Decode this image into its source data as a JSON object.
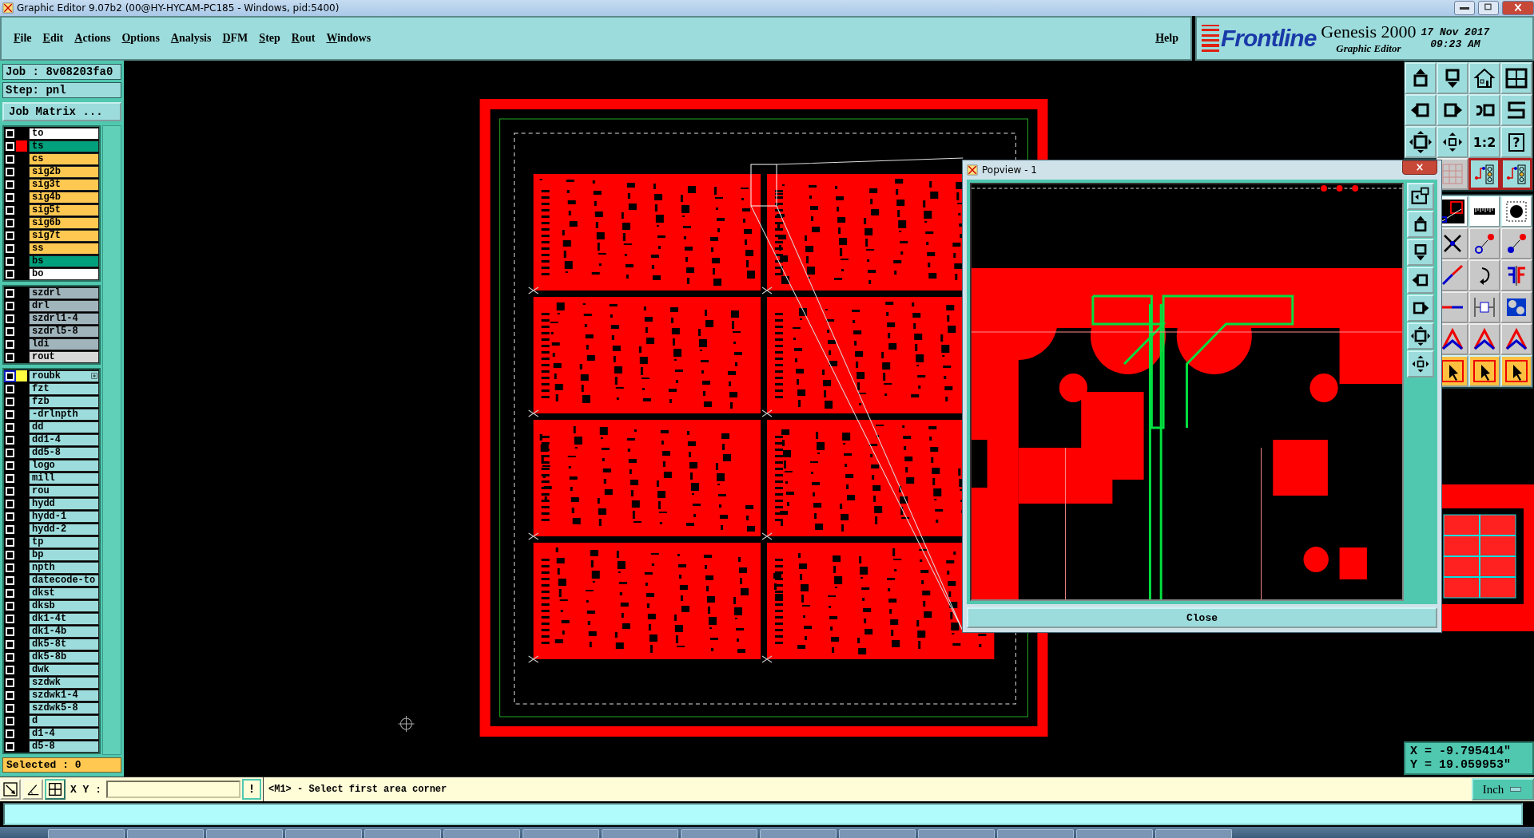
{
  "window": {
    "title": "Graphic Editor 9.07b2 (00@HY-HYCAM-PC185 - Windows, pid:5400)"
  },
  "menu": [
    "File",
    "Edit",
    "Actions",
    "Options",
    "Analysis",
    "DFM",
    "Step",
    "Rout",
    "Windows"
  ],
  "help": "Help",
  "brand": {
    "logo": "Frontline",
    "product": "Genesis 2000",
    "subtitle": "Graphic Editor",
    "date": "17 Nov 2017",
    "time": "09:23 AM"
  },
  "job": {
    "job": "Job : 8v08203fa0",
    "step": "Step: pnl",
    "matrix_button": "Job Matrix ..."
  },
  "layer_groups": [
    {
      "layers": [
        {
          "name": "to",
          "color": "#ffffff",
          "work_layer": false
        },
        {
          "name": "ts",
          "color": "#00a07c",
          "swatch": {
            "color": "#ff0000"
          },
          "work_layer": false
        },
        {
          "name": "cs",
          "color": "#ffc850",
          "work_layer": false
        },
        {
          "name": "sig2b",
          "color": "#ffc850",
          "work_layer": false
        },
        {
          "name": "sig3t",
          "color": "#ffc850",
          "work_layer": false
        },
        {
          "name": "sig4b",
          "color": "#ffc850",
          "work_layer": false
        },
        {
          "name": "sig5t",
          "color": "#ffc850",
          "work_layer": false
        },
        {
          "name": "sig6b",
          "color": "#ffc850",
          "work_layer": false
        },
        {
          "name": "sig7t",
          "color": "#ffc850",
          "work_layer": false
        },
        {
          "name": "ss",
          "color": "#ffc850",
          "work_layer": false
        },
        {
          "name": "bs",
          "color": "#00a07c",
          "work_layer": false
        },
        {
          "name": "bo",
          "color": "#ffffff",
          "work_layer": false
        }
      ]
    },
    {
      "layers": [
        {
          "name": "szdrl",
          "color": "#a0b4bc",
          "work_layer": false
        },
        {
          "name": "drl",
          "color": "#a0b4bc",
          "work_layer": false
        },
        {
          "name": "szdrl1-4",
          "color": "#a0b4bc",
          "work_layer": false
        },
        {
          "name": "szdrl5-8",
          "color": "#a0b4bc",
          "work_layer": false
        },
        {
          "name": "ldi",
          "color": "#a0b4bc",
          "work_layer": false
        },
        {
          "name": "rout",
          "color": "#d8d8d8",
          "work_layer": false
        }
      ]
    },
    {
      "layers": [
        {
          "name": "roubk",
          "color": "#9cdcdc",
          "swatch": {
            "color": "#ffff40"
          },
          "work_layer": true
        },
        {
          "name": "fzt",
          "color": "#9cdcdc",
          "work_layer": false
        },
        {
          "name": "fzb",
          "color": "#9cdcdc",
          "work_layer": false
        },
        {
          "name": "-drlnpth",
          "color": "#9cdcdc",
          "work_layer": false
        },
        {
          "name": "dd",
          "color": "#9cdcdc",
          "work_layer": false
        },
        {
          "name": "dd1-4",
          "color": "#9cdcdc",
          "work_layer": false
        },
        {
          "name": "dd5-8",
          "color": "#9cdcdc",
          "work_layer": false
        },
        {
          "name": "logo",
          "color": "#9cdcdc",
          "work_layer": false
        },
        {
          "name": "mill",
          "color": "#9cdcdc",
          "work_layer": false
        },
        {
          "name": "rou",
          "color": "#9cdcdc",
          "work_layer": false
        },
        {
          "name": "hydd",
          "color": "#9cdcdc",
          "work_layer": false
        },
        {
          "name": "hydd-1",
          "color": "#9cdcdc",
          "work_layer": false
        },
        {
          "name": "hydd-2",
          "color": "#9cdcdc",
          "work_layer": false
        },
        {
          "name": "tp",
          "color": "#9cdcdc",
          "work_layer": false
        },
        {
          "name": "bp",
          "color": "#9cdcdc",
          "work_layer": false
        },
        {
          "name": "npth",
          "color": "#9cdcdc",
          "work_layer": false
        },
        {
          "name": "datecode-to",
          "color": "#9cdcdc",
          "work_layer": false
        },
        {
          "name": "dkst",
          "color": "#9cdcdc",
          "work_layer": false
        },
        {
          "name": "dksb",
          "color": "#9cdcdc",
          "work_layer": false
        },
        {
          "name": "dk1-4t",
          "color": "#9cdcdc",
          "work_layer": false
        },
        {
          "name": "dk1-4b",
          "color": "#9cdcdc",
          "work_layer": false
        },
        {
          "name": "dk5-8t",
          "color": "#9cdcdc",
          "work_layer": false
        },
        {
          "name": "dk5-8b",
          "color": "#9cdcdc",
          "work_layer": false
        },
        {
          "name": "dwk",
          "color": "#9cdcdc",
          "work_layer": false
        },
        {
          "name": "szdwk",
          "color": "#9cdcdc",
          "work_layer": false
        },
        {
          "name": "szdwk1-4",
          "color": "#9cdcdc",
          "work_layer": false
        },
        {
          "name": "szdwk5-8",
          "color": "#9cdcdc",
          "work_layer": false
        },
        {
          "name": "d",
          "color": "#9cdcdc",
          "work_layer": false
        },
        {
          "name": "d1-4",
          "color": "#9cdcdc",
          "work_layer": false
        },
        {
          "name": "d5-8",
          "color": "#9cdcdc",
          "work_layer": false
        }
      ]
    }
  ],
  "selected_count": "Selected : 0",
  "toolbar": {
    "labels": [
      "1:2",
      "?"
    ]
  },
  "popview": {
    "title": "Popview - 1",
    "close_button": "Close"
  },
  "coordinates": {
    "x": "X = -9.795414\"",
    "y": "Y = 19.059953\""
  },
  "command_bar": {
    "xy_label": "X Y :",
    "confirm": "!",
    "prompt": "<M1> - Select first area corner",
    "units": "Inch"
  }
}
